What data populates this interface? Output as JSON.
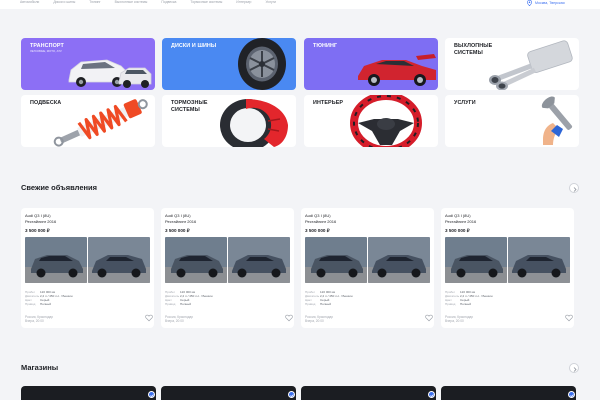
{
  "topnav": {
    "items": [
      "Автомобили",
      "Диски и шины",
      "Тюнинг",
      "Выхлопные системы",
      "Подвеска",
      "Тормозные системы",
      "Интерьер",
      "Услуги"
    ],
    "location": "Москва, Тверская"
  },
  "categories": [
    {
      "label": "Транспорт",
      "sublabel": "Легковые, мото, ATV",
      "color": "#8c6ff5",
      "text_color": "#ffffff",
      "icon": "car-icon"
    },
    {
      "label": "Диски и шины",
      "sublabel": "",
      "color": "#4a89f2",
      "text_color": "#ffffff",
      "icon": "tire-icon"
    },
    {
      "label": "Тюнинг",
      "sublabel": "",
      "color": "#7e6ef3",
      "text_color": "#ffffff",
      "icon": "tuned-car-icon"
    },
    {
      "label": "Выхлопные системы",
      "sublabel": "",
      "color": "#ffffff",
      "text_color": "#1d1f24",
      "icon": "exhaust-icon"
    },
    {
      "label": "Подвеска",
      "sublabel": "",
      "color": "#ffffff",
      "text_color": "#1d1f24",
      "icon": "shock-absorber-icon"
    },
    {
      "label": "Тормозные системы",
      "sublabel": "",
      "color": "#ffffff",
      "text_color": "#1d1f24",
      "icon": "brake-caliper-icon"
    },
    {
      "label": "Интерьер",
      "sublabel": "",
      "color": "#ffffff",
      "text_color": "#1d1f24",
      "icon": "steering-wheel-icon"
    },
    {
      "label": "Услуги",
      "sublabel": "",
      "color": "#ffffff",
      "text_color": "#1d1f24",
      "icon": "wrench-icon"
    }
  ],
  "fresh": {
    "title": "Свежие объявления",
    "listings": [
      {
        "title": "Audi Q3 I (8U)",
        "subtitle": "Рестайлинг 2016",
        "price": "3 500 000 ₽",
        "specs": [
          {
            "k": "Пробег",
            "v": "120 000 км"
          },
          {
            "k": "Двигатель",
            "v": "2,2 л / 450 л.с. / Бензин"
          },
          {
            "k": "Цвет",
            "v": "Серый"
          },
          {
            "k": "Привод",
            "v": "Полный"
          }
        ],
        "location": "Россия, Краснодар",
        "date": "Вчера, 20:00"
      },
      {
        "title": "Audi Q3 I (8U)",
        "subtitle": "Рестайлинг 2016",
        "price": "3 500 000 ₽",
        "specs": [
          {
            "k": "Пробег",
            "v": "120 000 км"
          },
          {
            "k": "Двигатель",
            "v": "2,2 л / 450 л.с. / Бензин"
          },
          {
            "k": "Цвет",
            "v": "Серый"
          },
          {
            "k": "Привод",
            "v": "Полный"
          }
        ],
        "location": "Россия, Краснодар",
        "date": "Вчера, 20:00"
      },
      {
        "title": "Audi Q3 I (8U)",
        "subtitle": "Рестайлинг 2016",
        "price": "3 500 000 ₽",
        "specs": [
          {
            "k": "Пробег",
            "v": "120 000 км"
          },
          {
            "k": "Двигатель",
            "v": "2,2 л / 450 л.с. / Бензин"
          },
          {
            "k": "Цвет",
            "v": "Серый"
          },
          {
            "k": "Привод",
            "v": "Полный"
          }
        ],
        "location": "Россия, Краснодар",
        "date": "Вчера, 20:00"
      },
      {
        "title": "Audi Q3 I (8U)",
        "subtitle": "Рестайлинг 2016",
        "price": "3 500 000 ₽",
        "specs": [
          {
            "k": "Пробег",
            "v": "120 000 км"
          },
          {
            "k": "Двигатель",
            "v": "2,2 л / 450 л.с. / Бензин"
          },
          {
            "k": "Цвет",
            "v": "Серый"
          },
          {
            "k": "Привод",
            "v": "Полный"
          }
        ],
        "location": "Россия, Краснодар",
        "date": "Вчера, 20:00"
      }
    ]
  },
  "shops": {
    "title": "Магазины"
  },
  "colors": {
    "accent": "#3b6ff0",
    "page_bg": "#f3f4f7"
  }
}
